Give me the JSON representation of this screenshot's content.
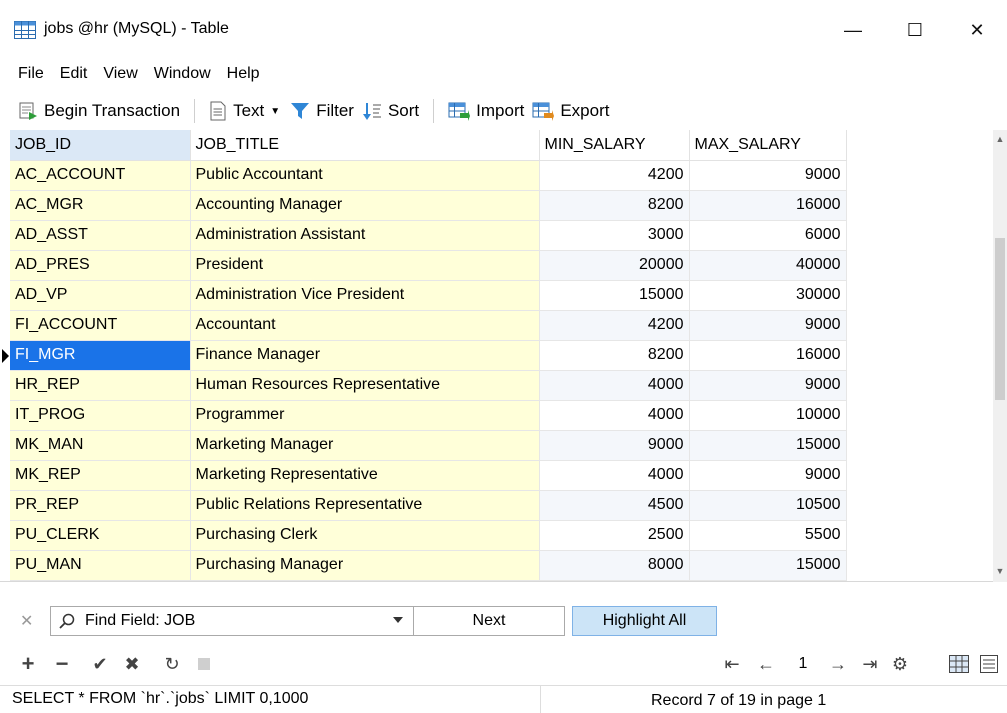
{
  "window": {
    "title": "jobs @hr (MySQL) - Table",
    "minimize": "—",
    "maximize": "☐",
    "close": "✕"
  },
  "menu": [
    "File",
    "Edit",
    "View",
    "Window",
    "Help"
  ],
  "toolbar": {
    "begin_transaction": "Begin Transaction",
    "text": "Text",
    "filter": "Filter",
    "sort": "Sort",
    "import": "Import",
    "export": "Export"
  },
  "grid": {
    "columns": [
      "JOB_ID",
      "JOB_TITLE",
      "MIN_SALARY",
      "MAX_SALARY"
    ],
    "rows": [
      [
        "AC_ACCOUNT",
        "Public Accountant",
        "4200",
        "9000"
      ],
      [
        "AC_MGR",
        "Accounting Manager",
        "8200",
        "16000"
      ],
      [
        "AD_ASST",
        "Administration Assistant",
        "3000",
        "6000"
      ],
      [
        "AD_PRES",
        "President",
        "20000",
        "40000"
      ],
      [
        "AD_VP",
        "Administration Vice President",
        "15000",
        "30000"
      ],
      [
        "FI_ACCOUNT",
        "Accountant",
        "4200",
        "9000"
      ],
      [
        "FI_MGR",
        "Finance Manager",
        "8200",
        "16000"
      ],
      [
        "HR_REP",
        "Human Resources Representative",
        "4000",
        "9000"
      ],
      [
        "IT_PROG",
        "Programmer",
        "4000",
        "10000"
      ],
      [
        "MK_MAN",
        "Marketing Manager",
        "9000",
        "15000"
      ],
      [
        "MK_REP",
        "Marketing Representative",
        "4000",
        "9000"
      ],
      [
        "PR_REP",
        "Public Relations Representative",
        "4500",
        "10500"
      ],
      [
        "PU_CLERK",
        "Purchasing Clerk",
        "2500",
        "5500"
      ],
      [
        "PU_MAN",
        "Purchasing Manager",
        "8000",
        "15000"
      ]
    ],
    "selected_row": 6
  },
  "find": {
    "value": "Find Field: JOB",
    "next_label": "Next",
    "highlight_label": "Highlight All"
  },
  "nav": {
    "page": "1"
  },
  "status": {
    "sql": "SELECT * FROM `hr`.`jobs` LIMIT 0,1000",
    "record": "Record 7 of 19 in page 1"
  },
  "colors": {
    "selected": "#1a73e8",
    "key_cell_bg": "#ffffd9",
    "header_highlight": "#dbe8f6",
    "highlight_button": "#cce4f7"
  }
}
